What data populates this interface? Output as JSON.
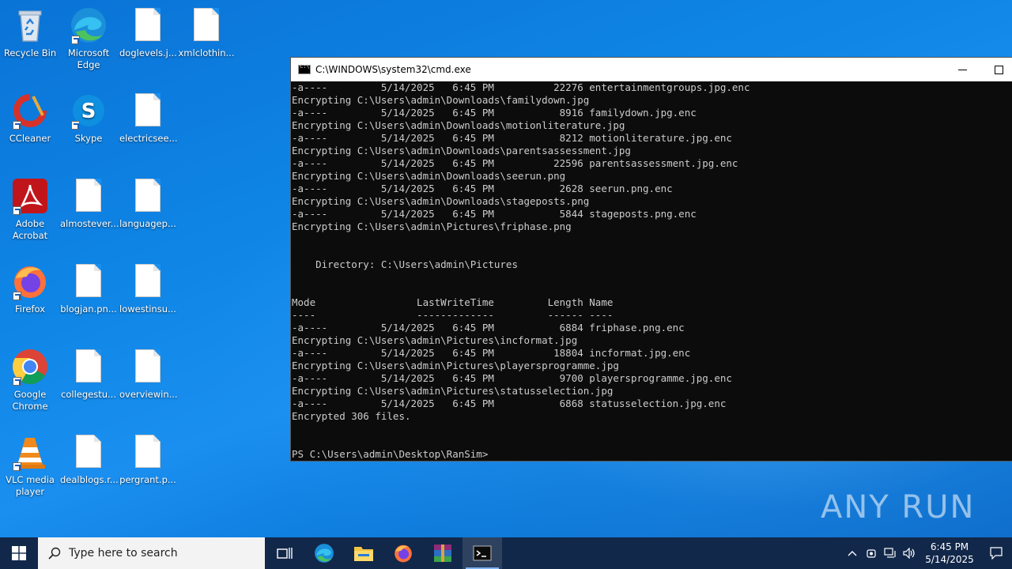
{
  "desktop_icons": [
    {
      "label": "Recycle Bin"
    },
    {
      "label": "Microsoft Edge"
    },
    {
      "label": "doglevels.j..."
    },
    {
      "label": "xmlclothin..."
    },
    {
      "label": "CCleaner"
    },
    {
      "label": "Skype"
    },
    {
      "label": "electricsee..."
    },
    {
      "label": "Adobe Acrobat"
    },
    {
      "label": "almostever..."
    },
    {
      "label": "languagep..."
    },
    {
      "label": "Firefox"
    },
    {
      "label": "blogjan.pn..."
    },
    {
      "label": "lowestinsu..."
    },
    {
      "label": "Google Chrome"
    },
    {
      "label": "collegestu..."
    },
    {
      "label": "overviewin..."
    },
    {
      "label": "VLC media player"
    },
    {
      "label": "dealblogs.r..."
    },
    {
      "label": "pergrant.p..."
    }
  ],
  "cmd": {
    "title": "C:\\WINDOWS\\system32\\cmd.exe",
    "lines": [
      "-a----         5/14/2025   6:45 PM          22276 entertainmentgroups.jpg.enc",
      "Encrypting C:\\Users\\admin\\Downloads\\familydown.jpg",
      "-a----         5/14/2025   6:45 PM           8916 familydown.jpg.enc",
      "Encrypting C:\\Users\\admin\\Downloads\\motionliterature.jpg",
      "-a----         5/14/2025   6:45 PM           8212 motionliterature.jpg.enc",
      "Encrypting C:\\Users\\admin\\Downloads\\parentsassessment.jpg",
      "-a----         5/14/2025   6:45 PM          22596 parentsassessment.jpg.enc",
      "Encrypting C:\\Users\\admin\\Downloads\\seerun.png",
      "-a----         5/14/2025   6:45 PM           2628 seerun.png.enc",
      "Encrypting C:\\Users\\admin\\Downloads\\stageposts.png",
      "-a----         5/14/2025   6:45 PM           5844 stageposts.png.enc",
      "Encrypting C:\\Users\\admin\\Pictures\\friphase.png",
      "",
      "",
      "    Directory: C:\\Users\\admin\\Pictures",
      "",
      "",
      "Mode                 LastWriteTime         Length Name",
      "----                 -------------         ------ ----",
      "-a----         5/14/2025   6:45 PM           6884 friphase.png.enc",
      "Encrypting C:\\Users\\admin\\Pictures\\incformat.jpg",
      "-a----         5/14/2025   6:45 PM          18804 incformat.jpg.enc",
      "Encrypting C:\\Users\\admin\\Pictures\\playersprogramme.jpg",
      "-a----         5/14/2025   6:45 PM           9700 playersprogramme.jpg.enc",
      "Encrypting C:\\Users\\admin\\Pictures\\statusselection.jpg",
      "-a----         5/14/2025   6:45 PM           6868 statusselection.jpg.enc",
      "Encrypted 306 files.",
      "",
      "",
      "PS C:\\Users\\admin\\Desktop\\RanSim>"
    ]
  },
  "watermark": {
    "text": "ANY RUN"
  },
  "taskbar": {
    "search_placeholder": "Type here to search",
    "apps": [
      "task-view",
      "edge",
      "file-explorer",
      "firefox",
      "winrar",
      "terminal"
    ],
    "clock_time": "6:45 PM",
    "clock_date": "5/14/2025"
  }
}
